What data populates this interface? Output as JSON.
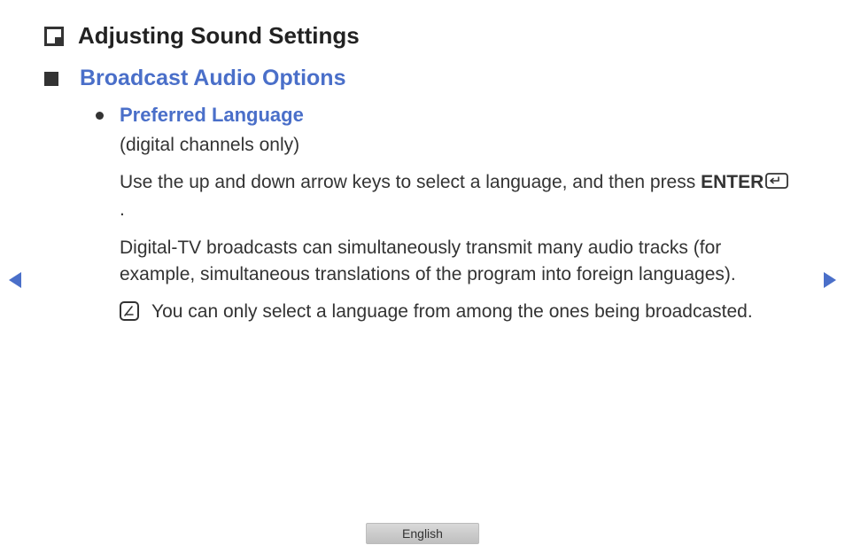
{
  "title": "Adjusting Sound Settings",
  "section": "Broadcast Audio Options",
  "subsection": "Preferred Language",
  "subnote": "(digital channels only)",
  "instruction_part1": "Use the up and down arrow keys to select a language, and then press ",
  "enter_label": "ENTER",
  "instruction_part2": ".",
  "description": "Digital-TV broadcasts can simultaneously transmit many audio tracks (for example, simultaneous translations of the program into foreign languages).",
  "note": "You can only select a language from among the ones being broadcasted.",
  "footer": "English"
}
